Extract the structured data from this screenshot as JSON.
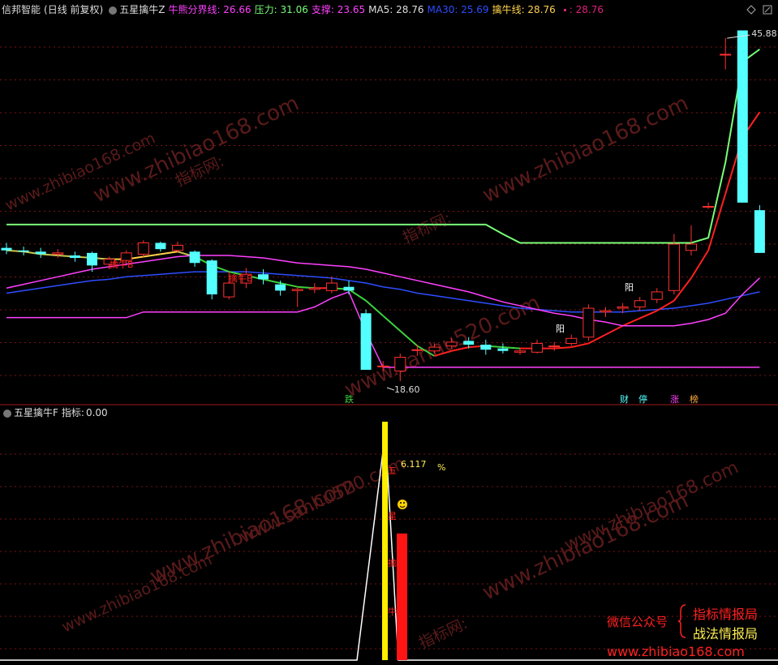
{
  "header": {
    "app": "信邦智能",
    "mode": "(日线 前复权)",
    "indicator": "五星擒牛Z",
    "fields": [
      {
        "label": "牛熊分界线:",
        "value": "26.66",
        "color": "#ff40ff"
      },
      {
        "label": "压力:",
        "value": "31.06",
        "color": "#78ff78"
      },
      {
        "label": "支撑:",
        "value": "23.65",
        "color": "#ff40ff"
      },
      {
        "label": "MA5:",
        "value": "28.76",
        "color": "#dddddd"
      },
      {
        "label": "MA30:",
        "value": "25.69",
        "color": "#2d4dff"
      },
      {
        "label": "擒牛线:",
        "value": "28.76",
        "color": "#ffd24a"
      }
    ],
    "trailing": ": 28.76"
  },
  "subpanel": {
    "indicator": "五星擒牛F",
    "label": "指标:",
    "value": "0.00"
  },
  "chart_data": {
    "type": "candlestick",
    "price_range": [
      17.5,
      47.5
    ],
    "annotations": {
      "high_label": "45.88",
      "low_label": "18.60",
      "marks": [
        "擒牛B",
        "擒牛B",
        "阳",
        "阳",
        "跌",
        "财",
        "停",
        "涨",
        "榜"
      ],
      "sub_value": "6.117",
      "sub_unit": "%",
      "sub_glyphs": [
        "五",
        "星",
        "擒",
        "牛"
      ]
    },
    "candles": [
      {
        "o": 29.2,
        "c": 29.0,
        "h": 29.6,
        "l": 28.7
      },
      {
        "o": 29.0,
        "c": 28.9,
        "h": 29.3,
        "l": 28.6
      },
      {
        "o": 28.9,
        "c": 28.7,
        "h": 29.2,
        "l": 28.4
      },
      {
        "o": 28.7,
        "c": 28.8,
        "h": 29.1,
        "l": 28.4
      },
      {
        "o": 28.6,
        "c": 28.4,
        "h": 28.9,
        "l": 28.1
      },
      {
        "o": 28.8,
        "c": 27.8,
        "h": 28.9,
        "l": 27.3
      },
      {
        "o": 27.9,
        "c": 28.3,
        "h": 28.5,
        "l": 27.5
      },
      {
        "o": 28.2,
        "c": 28.8,
        "h": 29.0,
        "l": 27.9
      },
      {
        "o": 28.7,
        "c": 29.6,
        "h": 29.8,
        "l": 28.5
      },
      {
        "o": 29.6,
        "c": 29.1,
        "h": 29.7,
        "l": 28.9
      },
      {
        "o": 29.0,
        "c": 29.4,
        "h": 29.7,
        "l": 28.8
      },
      {
        "o": 28.9,
        "c": 28.0,
        "h": 29.0,
        "l": 27.7
      },
      {
        "o": 28.2,
        "c": 25.5,
        "h": 28.3,
        "l": 25.1
      },
      {
        "o": 25.3,
        "c": 26.4,
        "h": 27.3,
        "l": 25.1
      },
      {
        "o": 26.4,
        "c": 27.1,
        "h": 27.6,
        "l": 26.0
      },
      {
        "o": 27.1,
        "c": 26.7,
        "h": 27.5,
        "l": 26.3
      },
      {
        "o": 26.3,
        "c": 25.8,
        "h": 26.6,
        "l": 25.4
      },
      {
        "o": 25.8,
        "c": 25.9,
        "h": 26.1,
        "l": 24.5
      },
      {
        "o": 25.9,
        "c": 26.0,
        "h": 26.4,
        "l": 25.6
      },
      {
        "o": 25.8,
        "c": 26.4,
        "h": 26.9,
        "l": 25.6
      },
      {
        "o": 26.1,
        "c": 25.8,
        "h": 26.6,
        "l": 25.5
      },
      {
        "o": 24.0,
        "c": 19.5,
        "h": 24.3,
        "l": 19.5
      },
      {
        "o": 19.8,
        "c": 19.8,
        "h": 20.2,
        "l": 19.4
      },
      {
        "o": 19.4,
        "c": 20.5,
        "h": 20.8,
        "l": 18.6
      },
      {
        "o": 21.1,
        "c": 21.1,
        "h": 21.5,
        "l": 20.6
      },
      {
        "o": 21.0,
        "c": 21.3,
        "h": 21.6,
        "l": 20.8
      },
      {
        "o": 21.4,
        "c": 21.7,
        "h": 22.0,
        "l": 21.2
      },
      {
        "o": 21.8,
        "c": 21.5,
        "h": 22.1,
        "l": 21.2
      },
      {
        "o": 21.5,
        "c": 21.1,
        "h": 21.9,
        "l": 20.7
      },
      {
        "o": 21.2,
        "c": 21.0,
        "h": 21.6,
        "l": 20.8
      },
      {
        "o": 20.9,
        "c": 21.0,
        "h": 21.2,
        "l": 20.7
      },
      {
        "o": 20.9,
        "c": 21.6,
        "h": 21.9,
        "l": 20.8
      },
      {
        "o": 21.4,
        "c": 21.4,
        "h": 21.7,
        "l": 21.0
      },
      {
        "o": 21.6,
        "c": 22.0,
        "h": 22.3,
        "l": 21.4
      },
      {
        "o": 22.1,
        "c": 24.4,
        "h": 24.7,
        "l": 21.8
      },
      {
        "o": 24.1,
        "c": 24.2,
        "h": 24.5,
        "l": 23.7
      },
      {
        "o": 24.4,
        "c": 24.5,
        "h": 24.8,
        "l": 24.0
      },
      {
        "o": 24.5,
        "c": 25.0,
        "h": 25.3,
        "l": 24.2
      },
      {
        "o": 25.1,
        "c": 25.7,
        "h": 26.0,
        "l": 24.8
      },
      {
        "o": 25.8,
        "c": 29.5,
        "h": 30.3,
        "l": 25.5
      },
      {
        "o": 29.0,
        "c": 29.5,
        "h": 31.0,
        "l": 28.6
      },
      {
        "o": 32.5,
        "c": 32.5,
        "h": 32.8,
        "l": 32.3
      },
      {
        "o": 44.6,
        "c": 44.6,
        "h": 45.9,
        "l": 43.4
      },
      {
        "o": 46.5,
        "c": 32.8,
        "h": 46.5,
        "l": 32.8
      },
      {
        "o": 32.2,
        "c": 28.8,
        "h": 32.6,
        "l": 28.8
      }
    ],
    "series": [
      {
        "name": "压力",
        "color": "#78ff78",
        "values": [
          31.06,
          31.06,
          31.06,
          31.06,
          31.06,
          31.06,
          31.06,
          31.06,
          31.06,
          31.06,
          31.06,
          31.06,
          31.06,
          31.06,
          31.06,
          31.06,
          31.06,
          31.06,
          31.06,
          31.06,
          31.06,
          31.06,
          31.06,
          31.06,
          31.06,
          31.06,
          31.06,
          31.06,
          31.06,
          30.3,
          29.6,
          29.6,
          29.6,
          29.6,
          29.6,
          29.6,
          29.6,
          29.6,
          29.6,
          29.6,
          29.6,
          30.0,
          36.0,
          44.0,
          45.0
        ]
      },
      {
        "name": "MA30",
        "color": "#2d4dff",
        "values": [
          25.6,
          25.8,
          26.0,
          26.2,
          26.4,
          26.6,
          26.7,
          26.9,
          27.0,
          27.1,
          27.2,
          27.3,
          27.3,
          27.3,
          27.3,
          27.2,
          27.1,
          27.0,
          26.9,
          26.8,
          26.6,
          26.4,
          26.1,
          25.9,
          25.6,
          25.4,
          25.2,
          25.0,
          24.8,
          24.6,
          24.4,
          24.3,
          24.2,
          24.1,
          24.1,
          24.1,
          24.1,
          24.2,
          24.3,
          24.4,
          24.6,
          24.8,
          25.1,
          25.4,
          25.7
        ]
      },
      {
        "name": "支撑",
        "color": "#ff40ff",
        "values": [
          23.65,
          23.65,
          23.65,
          23.65,
          23.65,
          23.65,
          23.65,
          23.65,
          24.1,
          24.1,
          24.1,
          24.1,
          24.1,
          24.1,
          24.1,
          24.1,
          24.1,
          24.1,
          24.5,
          25.2,
          25.7,
          22.5,
          19.7,
          19.7,
          19.7,
          19.7,
          19.7,
          19.7,
          19.7,
          19.7,
          19.7,
          19.7,
          19.7,
          19.7,
          19.7,
          19.7,
          19.7,
          19.7,
          19.7,
          19.7,
          19.7,
          19.7,
          19.7,
          19.7,
          19.7
        ]
      },
      {
        "name": "擒牛线",
        "color": "#ffd24a",
        "values": [
          29.0,
          28.9,
          28.7,
          28.6,
          28.5,
          28.4,
          28.3,
          28.3,
          28.5,
          28.7,
          28.9,
          28.5,
          27.8,
          27.3,
          27.0,
          26.7,
          26.4,
          26.1,
          26.0,
          26.0,
          25.9,
          25.0,
          23.8,
          22.6,
          21.4,
          20.6,
          21.0,
          21.3,
          21.4,
          21.3,
          21.2,
          21.2,
          21.2,
          21.3,
          21.6,
          22.3,
          23.0,
          23.6,
          24.2,
          25.0,
          26.8,
          29.0,
          33.5,
          38.0,
          40.0
        ]
      },
      {
        "name": "牛熊分界线",
        "color": "#ff40ff",
        "values": [
          26.0,
          26.3,
          26.6,
          26.9,
          27.2,
          27.5,
          27.7,
          27.9,
          28.1,
          28.3,
          28.5,
          28.6,
          28.6,
          28.6,
          28.5,
          28.4,
          28.2,
          28.0,
          27.9,
          27.8,
          27.7,
          27.5,
          27.2,
          26.9,
          26.6,
          26.3,
          26.0,
          25.7,
          25.3,
          24.9,
          24.6,
          24.3,
          24.0,
          23.8,
          23.5,
          23.3,
          23.0,
          23.0,
          23.0,
          23.0,
          23.2,
          23.5,
          24.0,
          25.5,
          26.8
        ]
      }
    ],
    "sub_series": {
      "name": "五星擒牛F",
      "color": "#ffffff",
      "range": [
        0,
        6.4
      ],
      "values": [
        0,
        6.117,
        0
      ]
    },
    "sub_bars": [
      {
        "color": "#ffee00",
        "value": 6.5
      },
      {
        "color": "#ff1414",
        "value": 3.4
      }
    ]
  },
  "watermarks": {
    "sites": [
      "www.zhibiao168.com",
      "www.sanhu520.com",
      "指标网:"
    ],
    "footer": {
      "left": "微信公众号",
      "right_top": "指标情报局",
      "right_bottom": "战法情报局",
      "url": "www.zhibiao168.com"
    }
  }
}
